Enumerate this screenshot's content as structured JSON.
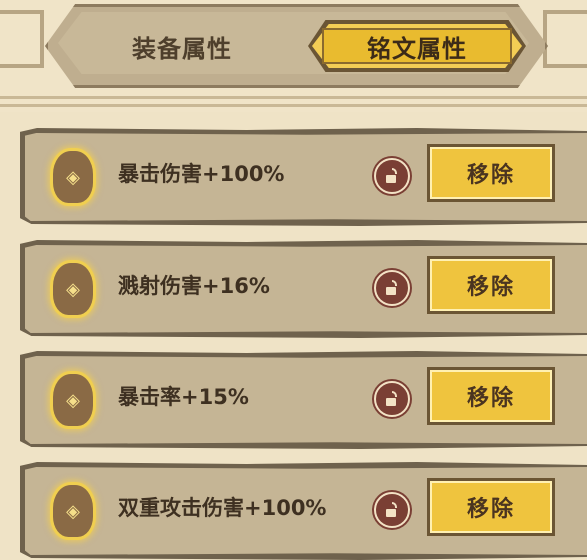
{
  "tabs": {
    "equipment_label": "装备属性",
    "rune_label": "铭文属性",
    "active": "rune"
  },
  "rows": [
    {
      "text": "暴击伤害+100%",
      "button": "移除"
    },
    {
      "text": "溅射伤害+16%",
      "button": "移除"
    },
    {
      "text": "暴击率+15%",
      "button": "移除"
    },
    {
      "text": "双重攻击伤害+100%",
      "button": "移除"
    }
  ],
  "colors": {
    "background": "#efe3c6",
    "plank": "#c5b595",
    "button_gold": "#efc43e",
    "lock_red": "#7a3f34"
  },
  "icons": [
    "rune-stone-icon",
    "unlocked-padlock-icon"
  ]
}
